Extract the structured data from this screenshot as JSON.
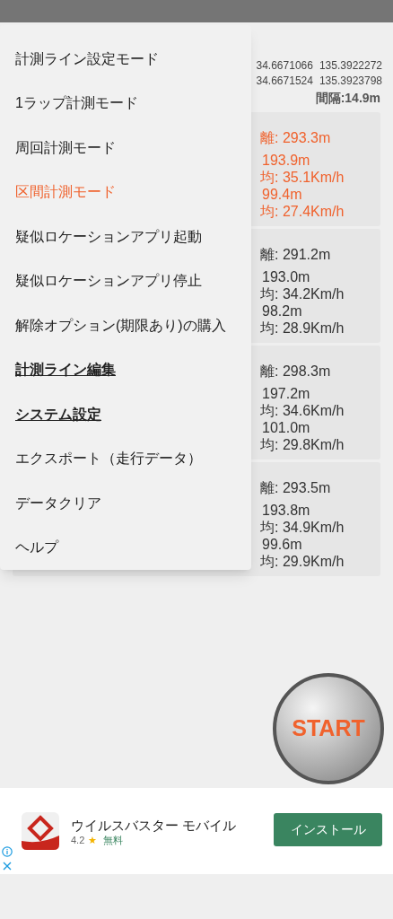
{
  "header": {
    "line_points": [
      {
        "lat": "34.6671066",
        "lon": "135.3922272"
      },
      {
        "lat": "34.6671524",
        "lon": "135.3923798"
      }
    ],
    "interval": "間隔:14.9m"
  },
  "laps": [
    {
      "highlight": true,
      "distance": "離: 293.3m",
      "lines": [
        "193.9m",
        "均: 35.1Km/h",
        "99.4m",
        "均: 27.4Km/h"
      ]
    },
    {
      "highlight": false,
      "distance": "離: 291.2m",
      "lines": [
        "193.0m",
        "均: 34.2Km/h",
        "98.2m",
        "均: 28.9Km/h"
      ]
    },
    {
      "highlight": false,
      "distance": "離: 298.3m",
      "lines": [
        "197.2m",
        "均: 34.6Km/h",
        "101.0m",
        "均: 29.8Km/h"
      ]
    },
    {
      "highlight": false,
      "distance": "離: 293.5m",
      "lines": [
        "193.8m",
        "均: 34.9Km/h",
        "99.6m",
        "均: 29.9Km/h"
      ]
    }
  ],
  "start_button": "START",
  "menu": [
    {
      "kind": "item",
      "label": "計測ライン設定モード",
      "selected": false
    },
    {
      "kind": "item",
      "label": "1ラップ計測モード",
      "selected": false
    },
    {
      "kind": "item",
      "label": "周回計測モード",
      "selected": false
    },
    {
      "kind": "item",
      "label": "区間計測モード",
      "selected": true
    },
    {
      "kind": "item",
      "label": "疑似ロケーションアプリ起動",
      "selected": false
    },
    {
      "kind": "item",
      "label": "疑似ロケーションアプリ停止",
      "selected": false
    },
    {
      "kind": "item",
      "label": "解除オプション(期限あり)の購入",
      "selected": false
    },
    {
      "kind": "section",
      "label": "計測ライン編集",
      "selected": false
    },
    {
      "kind": "section",
      "label": "システム設定",
      "selected": false
    },
    {
      "kind": "item",
      "label": "エクスポート（走行データ）",
      "selected": false
    },
    {
      "kind": "item",
      "label": "データクリア",
      "selected": false
    },
    {
      "kind": "item",
      "label": "ヘルプ",
      "selected": false
    }
  ],
  "ad": {
    "app_name": "ウイルスバスター モバイル",
    "rating": "4.2",
    "star": "★",
    "price": "無料",
    "button": "インストール"
  }
}
